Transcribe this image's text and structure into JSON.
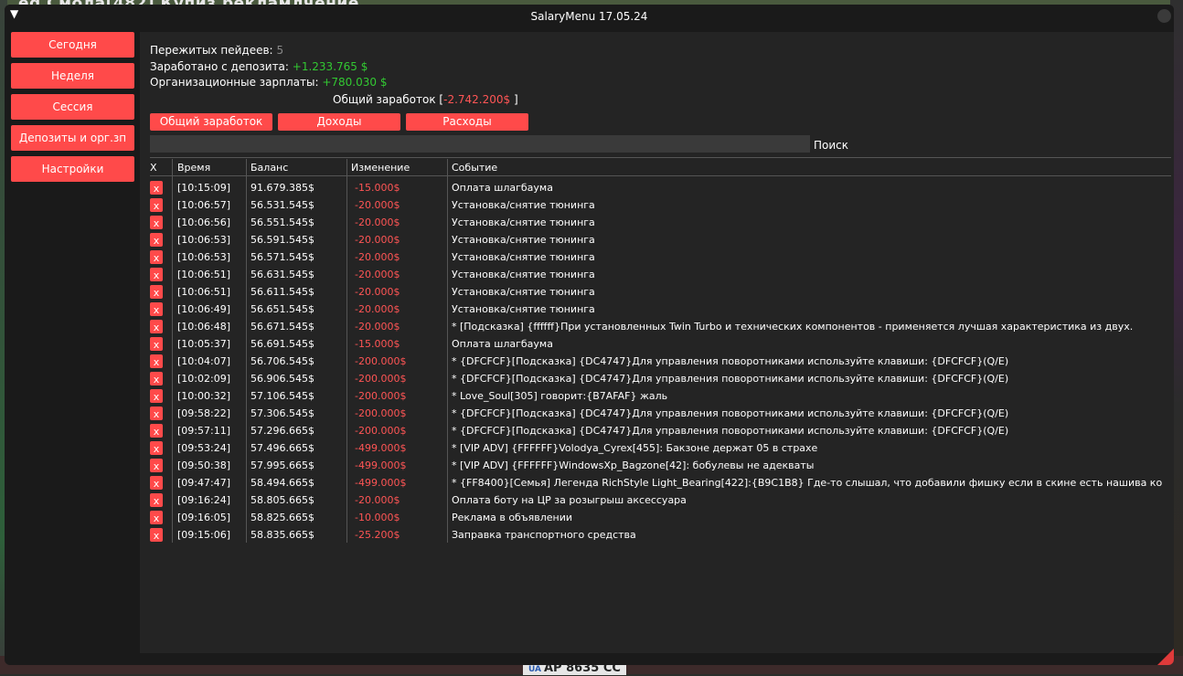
{
  "background": {
    "top_text": "ed Смола[482] Купиз рекламлчение",
    "plate_flag": "UA",
    "plate_text": "AP 8635 СС"
  },
  "window": {
    "title": "SalaryMenu 17.05.24",
    "collapse_icon": "▼"
  },
  "sidebar": {
    "items": [
      {
        "label": "Сегодня"
      },
      {
        "label": "Неделя"
      },
      {
        "label": "Сессия"
      },
      {
        "label": "Депозиты и орг.зп"
      },
      {
        "label": "Настройки"
      }
    ]
  },
  "stats": {
    "paydays_label": "Пережитых пейдеев:",
    "paydays_value": "5",
    "deposit_label": "Заработано с депозита:",
    "deposit_value": "+1.233.765 $",
    "org_label": "Организационные зарплаты:",
    "org_value": "+780.030 $",
    "total_label": "Общий заработок",
    "total_open": "[",
    "total_value": "-2.742.200$",
    "total_close": "]"
  },
  "tabs": [
    {
      "label": "Общий заработок"
    },
    {
      "label": "Доходы"
    },
    {
      "label": "Расходы"
    }
  ],
  "search": {
    "value": "",
    "label": "Поиск"
  },
  "table": {
    "columns": [
      "X",
      "Время",
      "Баланс",
      "Изменение",
      "Событие"
    ],
    "delete_glyph": "x",
    "rows": [
      {
        "time": "[10:15:09]",
        "balance": "91.679.385$",
        "change": "-15.000$",
        "event": "Оплата шлагбаума"
      },
      {
        "time": "[10:06:57]",
        "balance": "56.531.545$",
        "change": "-20.000$",
        "event": "Установка/снятие тюнинга"
      },
      {
        "time": "[10:06:56]",
        "balance": "56.551.545$",
        "change": "-20.000$",
        "event": "Установка/снятие тюнинга"
      },
      {
        "time": "[10:06:53]",
        "balance": "56.591.545$",
        "change": "-20.000$",
        "event": "Установка/снятие тюнинга"
      },
      {
        "time": "[10:06:53]",
        "balance": "56.571.545$",
        "change": "-20.000$",
        "event": "Установка/снятие тюнинга"
      },
      {
        "time": "[10:06:51]",
        "balance": "56.631.545$",
        "change": "-20.000$",
        "event": "Установка/снятие тюнинга"
      },
      {
        "time": "[10:06:51]",
        "balance": "56.611.545$",
        "change": "-20.000$",
        "event": "Установка/снятие тюнинга"
      },
      {
        "time": "[10:06:49]",
        "balance": "56.651.545$",
        "change": "-20.000$",
        "event": "Установка/снятие тюнинга"
      },
      {
        "time": "[10:06:48]",
        "balance": "56.671.545$",
        "change": "-20.000$",
        "event": "* [Подсказка] {ffffff}При установленных Twin Turbo и технических компонентов - применяется лучшая характеристика из двух."
      },
      {
        "time": "[10:05:37]",
        "balance": "56.691.545$",
        "change": "-15.000$",
        "event": "Оплата шлагбаума"
      },
      {
        "time": "[10:04:07]",
        "balance": "56.706.545$",
        "change": "-200.000$",
        "event": "* {DFCFCF}[Подсказка] {DC4747}Для управления поворотниками используйте клавиши: {DFCFCF}(Q/E)"
      },
      {
        "time": "[10:02:09]",
        "balance": "56.906.545$",
        "change": "-200.000$",
        "event": "* {DFCFCF}[Подсказка] {DC4747}Для управления поворотниками используйте клавиши: {DFCFCF}(Q/E)"
      },
      {
        "time": "[10:00:32]",
        "balance": "57.106.545$",
        "change": "-200.000$",
        "event": "* Love_Soul[305] говорит:{B7AFAF} жаль"
      },
      {
        "time": "[09:58:22]",
        "balance": "57.306.545$",
        "change": "-200.000$",
        "event": "* {DFCFCF}[Подсказка] {DC4747}Для управления поворотниками используйте клавиши: {DFCFCF}(Q/E)"
      },
      {
        "time": "[09:57:11]",
        "balance": "57.296.665$",
        "change": "-200.000$",
        "event": "* {DFCFCF}[Подсказка] {DC4747}Для управления поворотниками используйте клавиши: {DFCFCF}(Q/E)"
      },
      {
        "time": "[09:53:24]",
        "balance": "57.496.665$",
        "change": "-499.000$",
        "event": "* [VIP ADV] {FFFFFF}Volodya_Cyrex[455]: Бакзоне держат 05 в страхе"
      },
      {
        "time": "[09:50:38]",
        "balance": "57.995.665$",
        "change": "-499.000$",
        "event": "* [VIP ADV] {FFFFFF}WindowsXp_Bagzone[42]: бобулевы не адекваты"
      },
      {
        "time": "[09:47:47]",
        "balance": "58.494.665$",
        "change": "-499.000$",
        "event": "* {FF8400}[Семья]  Легенда RichStyle Light_Bearing[422]:{B9C1B8} Где-то слышал, что добавили фишку если в скине есть нашива ко"
      },
      {
        "time": "[09:16:24]",
        "balance": "58.805.665$",
        "change": "-20.000$",
        "event": "Оплата боту на ЦР за розыгрыш аксессуара"
      },
      {
        "time": "[09:16:05]",
        "balance": "58.825.665$",
        "change": "-10.000$",
        "event": "Реклама в объявлении"
      },
      {
        "time": "[09:15:06]",
        "balance": "58.835.665$",
        "change": "-25.200$",
        "event": "Заправка транспортного средства"
      }
    ]
  },
  "colors": {
    "accent": "#ff4a4a",
    "positive": "#32c832",
    "negative": "#ff5555",
    "window_bg": "#1a1a1a",
    "panel_bg": "#242424"
  }
}
